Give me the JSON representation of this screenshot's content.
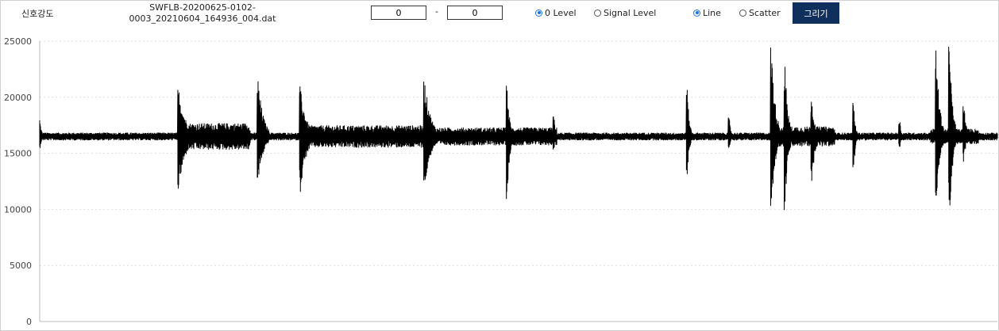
{
  "toolbar": {
    "title": "신호강도",
    "file_line1": "SWFLB-20200625-0102-",
    "file_line2": "0003_20210604_164936_004.dat",
    "range_from": "0",
    "range_sep": "-",
    "range_to": "0",
    "level_options": [
      {
        "label": "0 Level",
        "checked": true
      },
      {
        "label": "Signal Level",
        "checked": false
      }
    ],
    "plot_options": [
      {
        "label": "Line",
        "checked": true
      },
      {
        "label": "Scatter",
        "checked": false
      }
    ],
    "draw_button": "그리기",
    "accent_color": "#0f2f5c",
    "radio_color": "#1a73e8"
  },
  "chart_data": {
    "type": "line",
    "title": "",
    "xlabel": "",
    "ylabel": "",
    "ylim": [
      0,
      25000
    ],
    "yticks": [
      0,
      5000,
      10000,
      15000,
      20000,
      25000
    ],
    "grid": "horizontal dotted",
    "line_color": "#000000",
    "baseline": 16500,
    "noise_amplitude": 350,
    "x_range": [
      0,
      1000
    ],
    "bursts": [
      {
        "x": 0,
        "width": 4,
        "max": 18200,
        "min": 15200
      },
      {
        "x": 145,
        "width": 16,
        "max": 20900,
        "min": 11600
      },
      {
        "x": 228,
        "width": 12,
        "max": 21700,
        "min": 12300
      },
      {
        "x": 272,
        "width": 14,
        "max": 21000,
        "min": 11400
      },
      {
        "x": 402,
        "width": 14,
        "max": 21600,
        "min": 11800
      },
      {
        "x": 488,
        "width": 6,
        "max": 21100,
        "min": 10900
      },
      {
        "x": 537,
        "width": 3,
        "max": 18400,
        "min": 15300
      },
      {
        "x": 676,
        "width": 5,
        "max": 21000,
        "min": 12800
      },
      {
        "x": 720,
        "width": 4,
        "max": 18200,
        "min": 15400
      },
      {
        "x": 764,
        "width": 9,
        "max": 24800,
        "min": 9900
      },
      {
        "x": 778,
        "width": 7,
        "max": 23500,
        "min": 9500
      },
      {
        "x": 806,
        "width": 7,
        "max": 20300,
        "min": 11700
      },
      {
        "x": 850,
        "width": 4,
        "max": 19500,
        "min": 13100
      },
      {
        "x": 898,
        "width": 3,
        "max": 18200,
        "min": 15300
      },
      {
        "x": 936,
        "width": 8,
        "max": 24600,
        "min": 10200
      },
      {
        "x": 950,
        "width": 7,
        "max": 24700,
        "min": 9000
      },
      {
        "x": 965,
        "width": 5,
        "max": 19600,
        "min": 14100
      }
    ],
    "elevated_segments": [
      {
        "from": 150,
        "to": 220,
        "amplitude": 1200
      },
      {
        "from": 272,
        "to": 405,
        "amplitude": 1000
      },
      {
        "from": 405,
        "to": 540,
        "amplitude": 800
      },
      {
        "from": 766,
        "to": 830,
        "amplitude": 900
      },
      {
        "from": 930,
        "to": 980,
        "amplitude": 700
      }
    ]
  }
}
